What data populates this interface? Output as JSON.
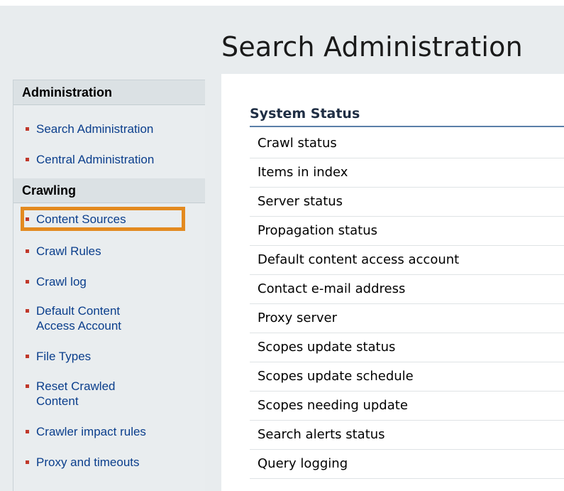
{
  "header": {
    "title": "Search Administration"
  },
  "left_nav": {
    "sections": [
      {
        "heading": "Administration",
        "items": [
          {
            "label": "Search Administration"
          },
          {
            "label": "Central Administration"
          }
        ]
      },
      {
        "heading": "Crawling",
        "items": [
          {
            "label": "Content Sources",
            "highlighted": true
          },
          {
            "label": "Crawl Rules"
          },
          {
            "label": "Crawl log"
          },
          {
            "label": "Default Content",
            "label_line2": "Access Account"
          },
          {
            "label": "File Types"
          },
          {
            "label": "Reset Crawled",
            "label_line2": "Content"
          },
          {
            "label": "Crawler impact rules"
          },
          {
            "label": "Proxy and timeouts"
          }
        ]
      }
    ]
  },
  "system_status": {
    "heading": "System Status",
    "rows": [
      "Crawl status",
      "Items in index",
      "Server status",
      "Propagation status",
      "Default content access account",
      "Contact e-mail address",
      "Proxy server",
      "Scopes update status",
      "Scopes update schedule",
      "Scopes needing update",
      "Search alerts status",
      "Query logging"
    ]
  },
  "colors": {
    "header_bg": "#e8ecee",
    "link": "#0a3e8c",
    "bullet": "#c0392b",
    "highlight": "#e38a20",
    "section_rule": "#5a7fa8"
  }
}
